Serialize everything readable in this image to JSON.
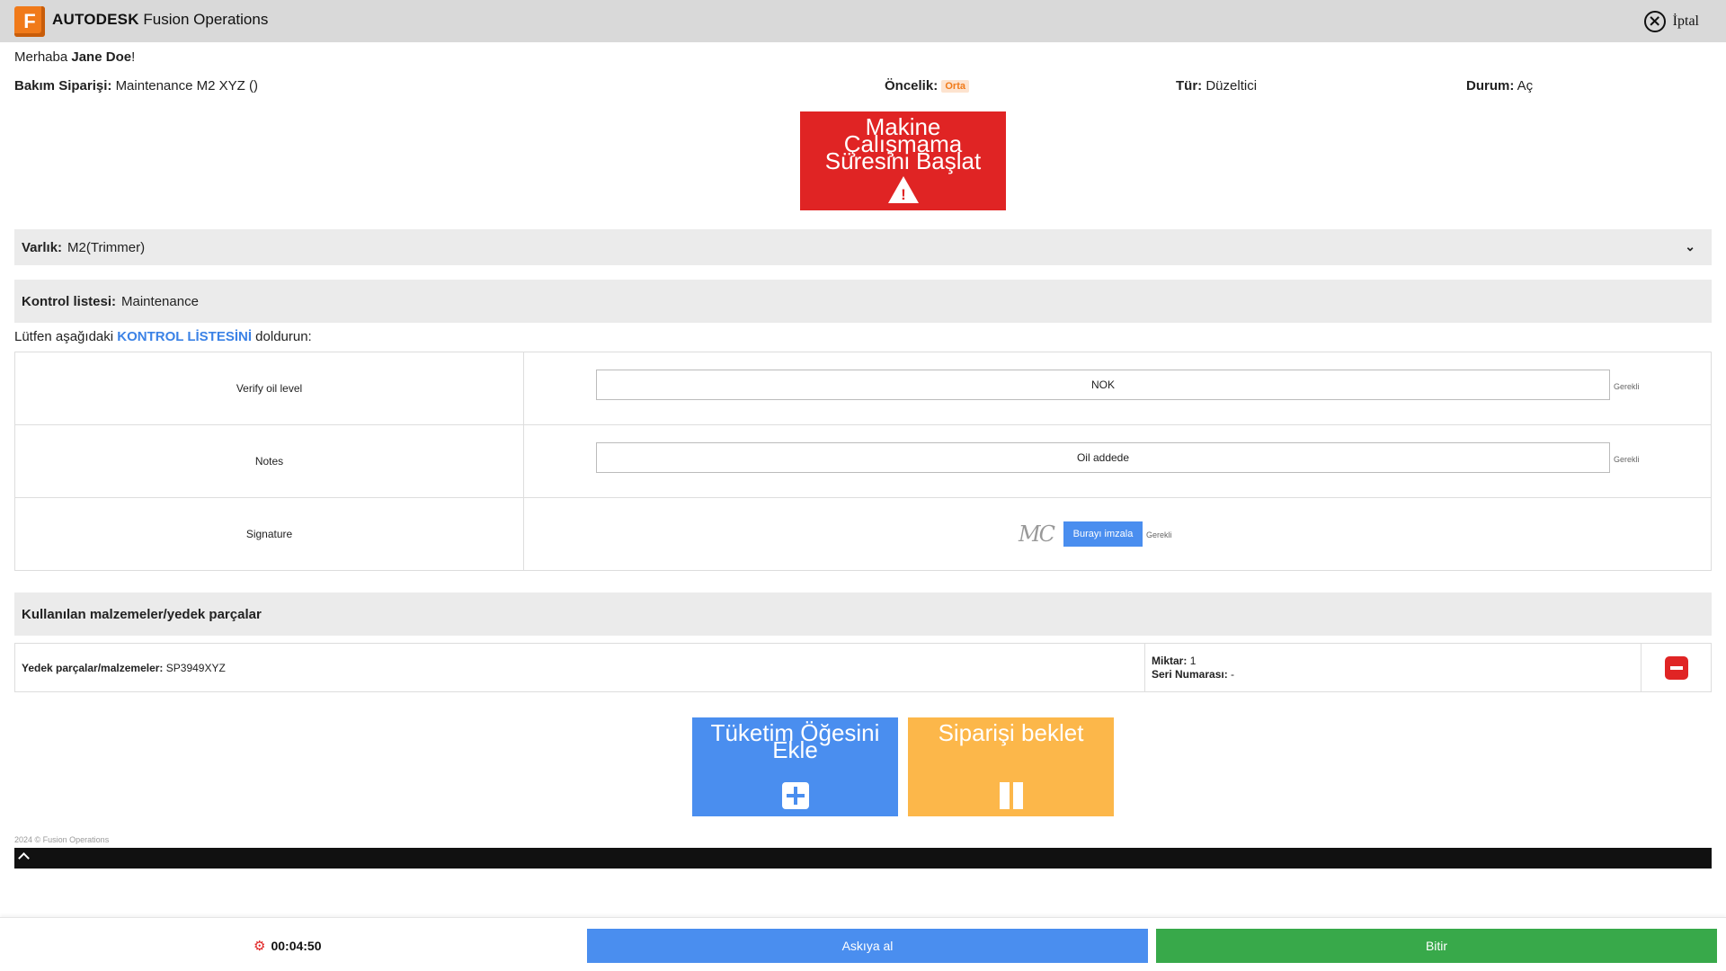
{
  "header": {
    "logo_letter": "F",
    "brand_bold": "AUTODESK",
    "brand_rest": "Fusion Operations",
    "cancel_label": "İptal"
  },
  "greeting": {
    "prefix": "Merhaba",
    "name": "Jane Doe",
    "suffix": "!"
  },
  "order": {
    "label": "Bakım Siparişi:",
    "value": "Maintenance M2 XYZ ()",
    "priority_label": "Öncelik:",
    "priority_value": "Orta",
    "type_label": "Tür:",
    "type_value": "Düzeltici",
    "status_label": "Durum:",
    "status_value": "Aç"
  },
  "downtime_button": {
    "label": "Makine Çalışmama Süresini Başlat",
    "icon": "warning-icon"
  },
  "asset": {
    "label": "Varlık:",
    "value": "M2(Trimmer)"
  },
  "checklist": {
    "label": "Kontrol listesi:",
    "value": "Maintenance",
    "instruction_prefix": "Lütfen aşağıdaki",
    "instruction_highlight": "KONTROL LİSTESİNİ",
    "instruction_suffix": "doldurun:",
    "rows": [
      {
        "label": "Verify oil level",
        "value": "NOK",
        "required": "Gerekli"
      },
      {
        "label": "Notes",
        "value": "Oil addede",
        "required": "Gerekli"
      },
      {
        "label": "Signature",
        "signature_text": "MC",
        "sign_button": "Burayı imzala",
        "required": "Gerekli"
      }
    ]
  },
  "materials": {
    "title": "Kullanılan malzemeler/yedek parçalar",
    "part_label": "Yedek parçalar/malzemeler:",
    "part_value": "SP3949XYZ",
    "qty_label": "Miktar:",
    "qty_value": "1",
    "serial_label": "Seri Numarası:",
    "serial_value": "-"
  },
  "actions": {
    "consume_label": "Tüketim Öğesini Ekle",
    "hold_label": "Siparişi beklet"
  },
  "footer": {
    "copyright": "2024 © Fusion Operations"
  },
  "bottom": {
    "timer": "00:04:50",
    "suspend_label": "Askıya al",
    "finish_label": "Bitir"
  },
  "colors": {
    "accent_blue": "#4a8eef",
    "danger_red": "#e02424",
    "warning_orange": "#fcb74a",
    "success_green": "#38a94a",
    "brand_orange": "#f07a1a"
  }
}
